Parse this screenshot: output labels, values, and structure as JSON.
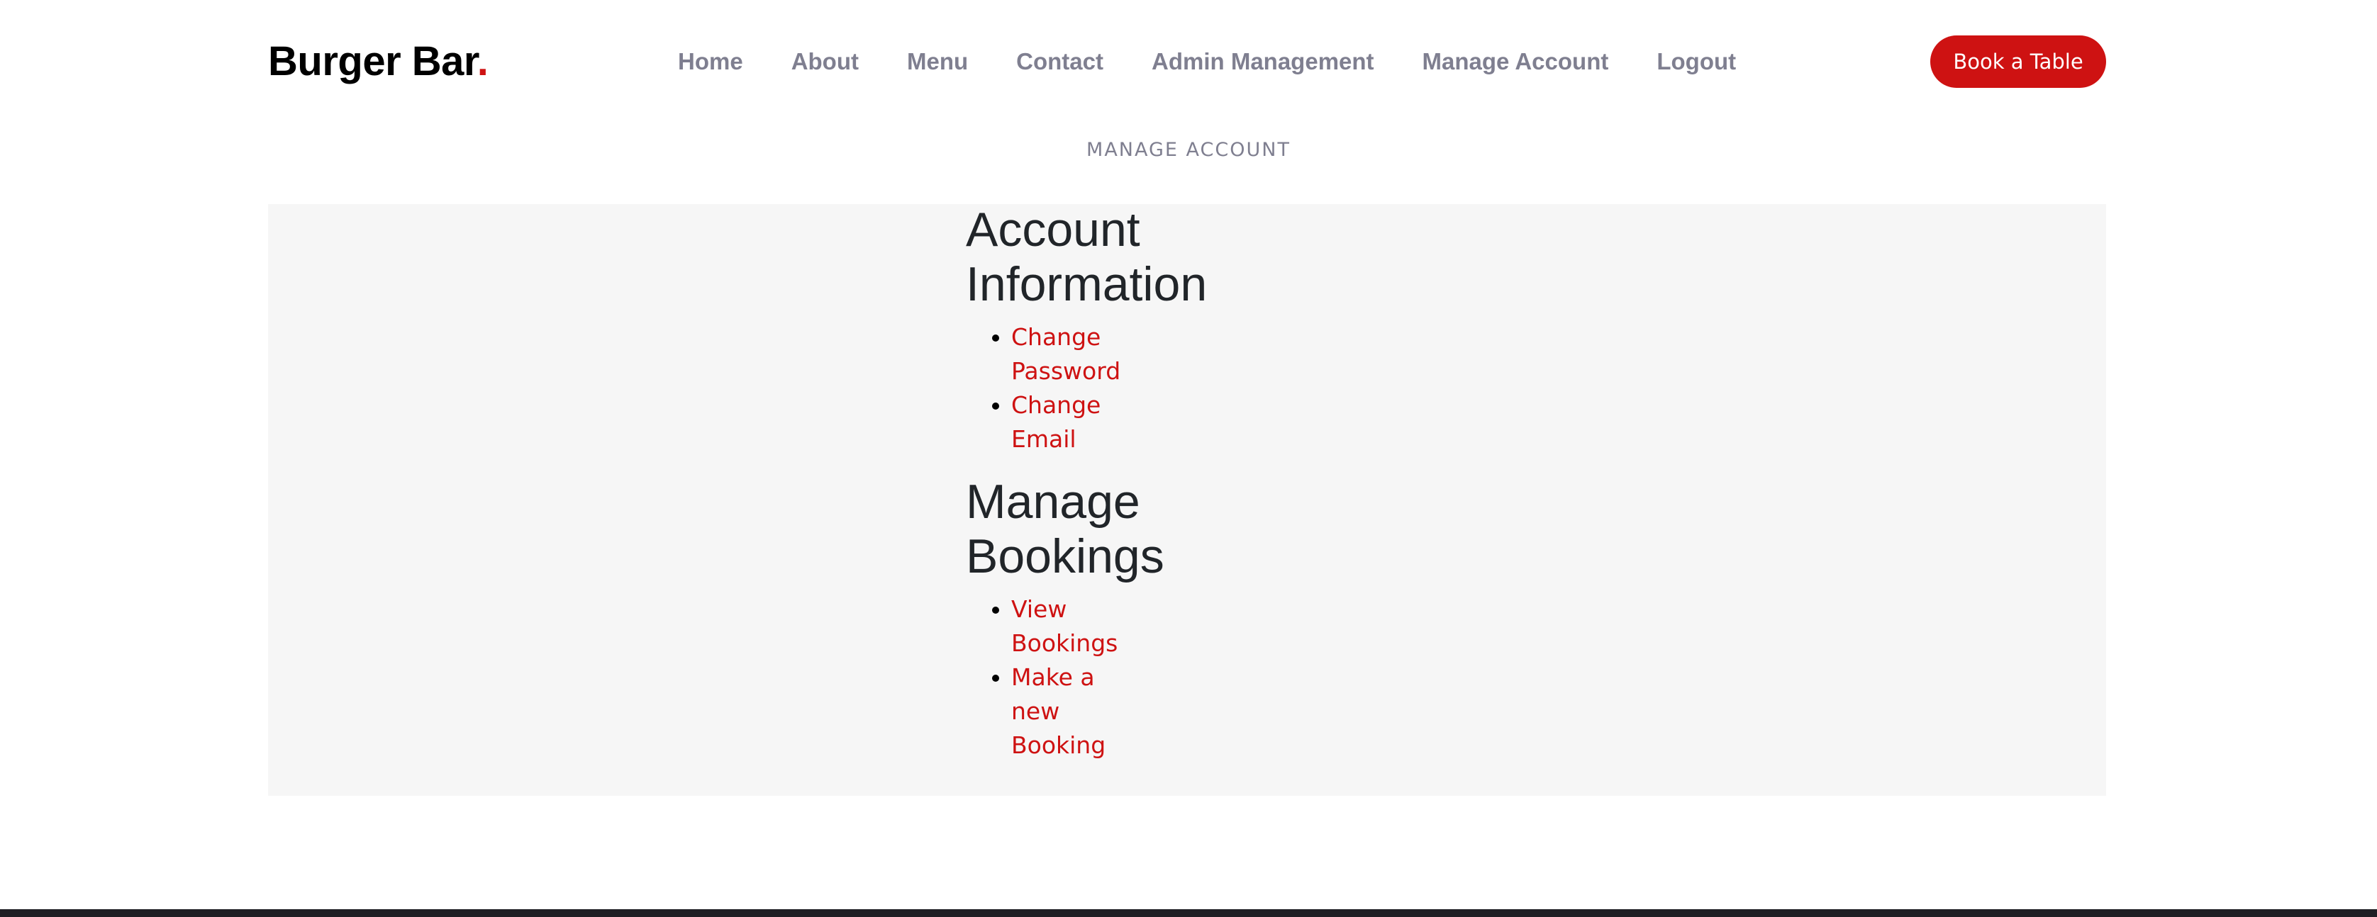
{
  "header": {
    "logo_text": "Burger Bar",
    "logo_dot": ".",
    "nav": [
      {
        "label": "Home"
      },
      {
        "label": "About"
      },
      {
        "label": "Menu"
      },
      {
        "label": "Contact"
      },
      {
        "label": "Admin Management"
      },
      {
        "label": "Manage Account"
      },
      {
        "label": "Logout"
      }
    ],
    "cta_label": "Book a Table"
  },
  "page": {
    "section_title": "Manage Account"
  },
  "account": {
    "heading": "Account Information",
    "links": [
      {
        "label": "Change Password"
      },
      {
        "label": "Change Email"
      }
    ]
  },
  "bookings": {
    "heading": "Manage Bookings",
    "links": [
      {
        "label": "View Bookings"
      },
      {
        "label": "Make a new Booking"
      }
    ]
  },
  "colors": {
    "accent": "#ce1212",
    "nav_text": "#7f7f90",
    "panel_bg": "#f6f6f6",
    "heading_text": "#212529",
    "footer_bg": "#1f1f24"
  }
}
